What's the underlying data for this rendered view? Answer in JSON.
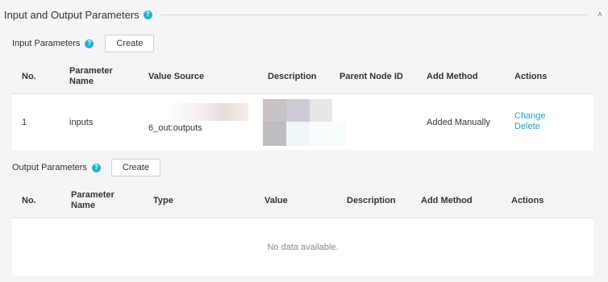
{
  "section": {
    "title": "Input and Output Parameters",
    "help_icon": "question-icon",
    "collapse_icon": "chevron-up-icon"
  },
  "input": {
    "title": "Input Parameters",
    "create_label": "Create",
    "columns": [
      "No.",
      "Parameter Name",
      "Value Source",
      "Description",
      "Parent Node ID",
      "Add Method",
      "Actions"
    ],
    "rows": [
      {
        "no": "1",
        "name": "inputs",
        "value_source": "6_out:outputs",
        "description": "",
        "parent_node_id": "",
        "add_method": "Added Manually",
        "actions": [
          "Change",
          "Delete"
        ]
      }
    ]
  },
  "output": {
    "title": "Output Parameters",
    "create_label": "Create",
    "columns": [
      "No.",
      "Parameter Name",
      "Type",
      "Value",
      "Description",
      "Add Method",
      "Actions"
    ],
    "empty_text": "No data available."
  },
  "colors": {
    "accent": "#1aa3c9",
    "help": "#21b2d6",
    "header_bg": "#f5f5f7"
  }
}
